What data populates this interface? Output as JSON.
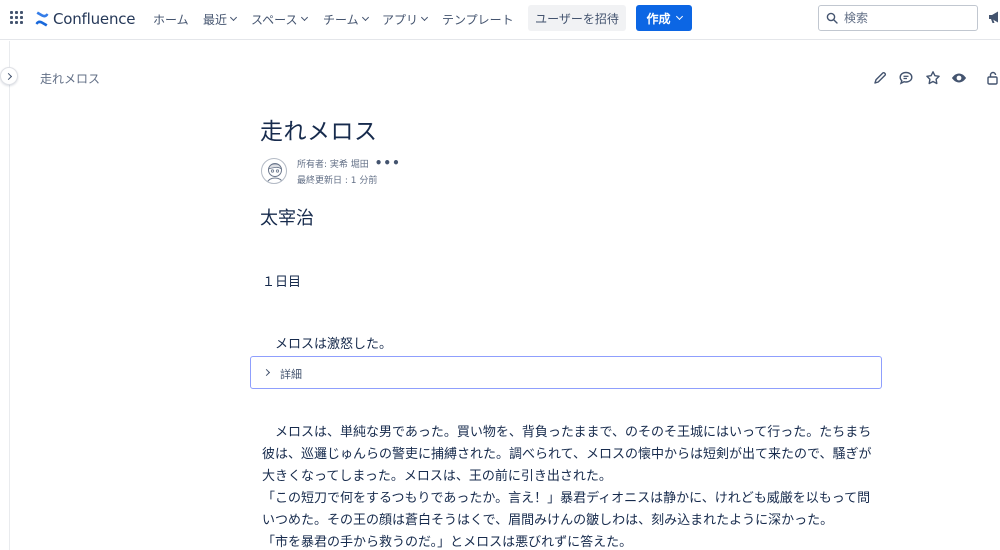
{
  "topbar": {
    "brand": "Confluence",
    "nav": [
      {
        "label": "ホーム",
        "dropdown": false
      },
      {
        "label": "最近",
        "dropdown": true
      },
      {
        "label": "スペース",
        "dropdown": true
      },
      {
        "label": "チーム",
        "dropdown": true
      },
      {
        "label": "アプリ",
        "dropdown": true
      },
      {
        "label": "テンプレート",
        "dropdown": false
      }
    ],
    "invite_label": "ユーザーを招待",
    "create_label": "作成",
    "search_placeholder": "検索",
    "accent_color": "#0c66e4"
  },
  "page": {
    "breadcrumb": "走れメロス",
    "title": "走れメロス",
    "owner": "所有者: 実希 堀田",
    "more": "•••",
    "updated": "最終更新日 : 1 分前",
    "toolbar_icons": [
      "edit-icon",
      "comment-icon",
      "star-icon",
      "watch-icon",
      "restrictions-icon"
    ]
  },
  "content": {
    "author": "太宰治",
    "day": "１日目",
    "intro": "　メロスは激怒した。",
    "expand_title": "詳細",
    "lines": [
      "　メロスは、単純な男であった。買い物を、背負ったままで、のそのそ王城にはいって行った。たちまち",
      "彼は、巡邏じゅんらの警吏に捕縛された。調べられて、メロスの懐中からは短剣が出て来たので、騒ぎが",
      "大きくなってしまった。メロスは、王の前に引き出された。",
      "「この短刀で何をするつもりであったか。言え！」暴君ディオニスは静かに、けれども威厳を以もって問",
      "いつめた。その王の顔は蒼白そうはくで、眉間みけんの皺しわは、刻み込まれたように深かった。",
      "「市を暴君の手から救うのだ。」とメロスは悪びれずに答えた。"
    ]
  }
}
